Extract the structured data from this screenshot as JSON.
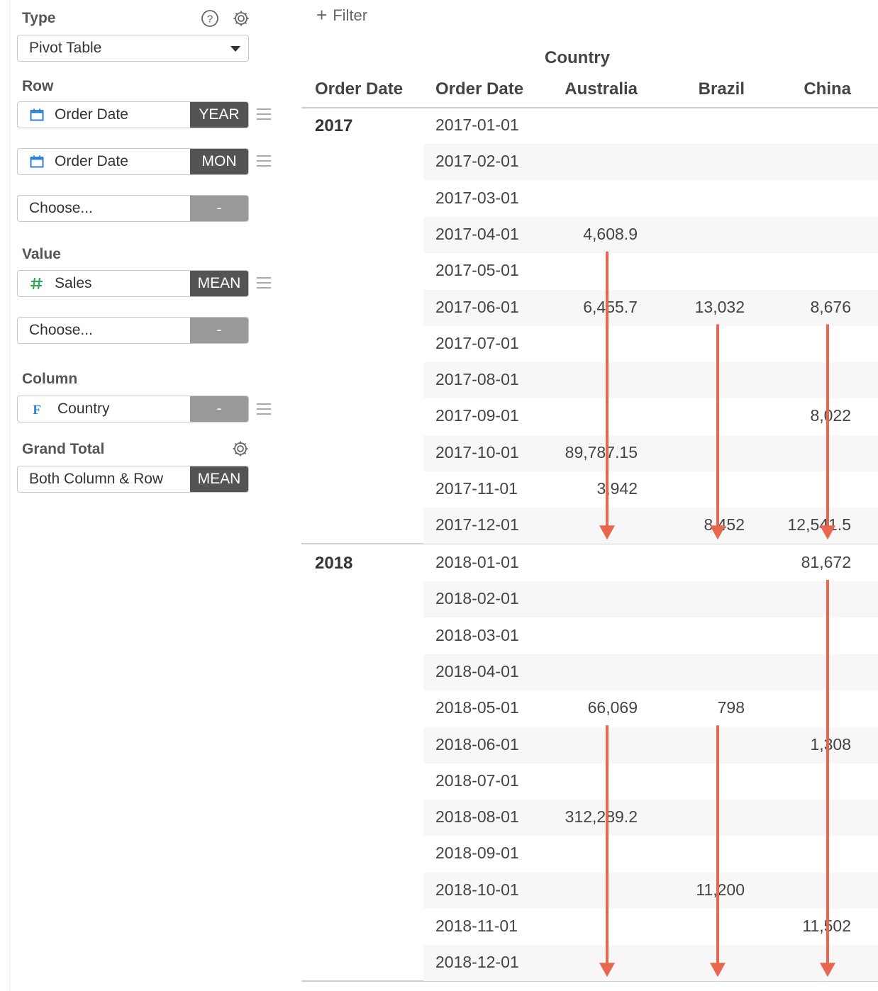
{
  "panel": {
    "type": {
      "label": "Type",
      "value": "Pivot Table"
    },
    "row": {
      "label": "Row",
      "fields": [
        {
          "name": "Order Date",
          "tag": "YEAR",
          "icon": "calendar-icon"
        },
        {
          "name": "Order Date",
          "tag": "MON",
          "icon": "calendar-icon"
        },
        {
          "name": "Choose...",
          "tag": "-"
        }
      ]
    },
    "value": {
      "label": "Value",
      "fields": [
        {
          "name": "Sales",
          "tag": "MEAN",
          "icon": "hash-icon"
        },
        {
          "name": "Choose...",
          "tag": "-"
        }
      ]
    },
    "column": {
      "label": "Column",
      "fields": [
        {
          "name": "Country",
          "tag": "-",
          "icon": "function-icon"
        }
      ]
    },
    "grand_total": {
      "label": "Grand Total",
      "value": "Both Column & Row",
      "tag": "MEAN"
    }
  },
  "toolbar": {
    "filter_label": "Filter"
  },
  "table": {
    "column_group": "Country",
    "headers": [
      "Order Date",
      "Order Date",
      "Australia",
      "Brazil",
      "China"
    ],
    "groups": [
      {
        "year": "2017",
        "rows": [
          {
            "date": "2017-01-01",
            "australia": "",
            "brazil": "",
            "china": ""
          },
          {
            "date": "2017-02-01",
            "australia": "",
            "brazil": "",
            "china": ""
          },
          {
            "date": "2017-03-01",
            "australia": "",
            "brazil": "",
            "china": ""
          },
          {
            "date": "2017-04-01",
            "australia": "4,608.9",
            "brazil": "",
            "china": ""
          },
          {
            "date": "2017-05-01",
            "australia": "",
            "brazil": "",
            "china": ""
          },
          {
            "date": "2017-06-01",
            "australia": "6,455.7",
            "brazil": "13,032",
            "china": "8,676"
          },
          {
            "date": "2017-07-01",
            "australia": "",
            "brazil": "",
            "china": ""
          },
          {
            "date": "2017-08-01",
            "australia": "",
            "brazil": "",
            "china": ""
          },
          {
            "date": "2017-09-01",
            "australia": "",
            "brazil": "",
            "china": "8,022"
          },
          {
            "date": "2017-10-01",
            "australia": "89,787.15",
            "brazil": "",
            "china": ""
          },
          {
            "date": "2017-11-01",
            "australia": "3,942",
            "brazil": "",
            "china": ""
          },
          {
            "date": "2017-12-01",
            "australia": "",
            "brazil": "8,452",
            "china": "12,541.5"
          }
        ]
      },
      {
        "year": "2018",
        "rows": [
          {
            "date": "2018-01-01",
            "australia": "",
            "brazil": "",
            "china": "81,672"
          },
          {
            "date": "2018-02-01",
            "australia": "",
            "brazil": "",
            "china": ""
          },
          {
            "date": "2018-03-01",
            "australia": "",
            "brazil": "",
            "china": ""
          },
          {
            "date": "2018-04-01",
            "australia": "",
            "brazil": "",
            "china": ""
          },
          {
            "date": "2018-05-01",
            "australia": "66,069",
            "brazil": "798",
            "china": ""
          },
          {
            "date": "2018-06-01",
            "australia": "",
            "brazil": "",
            "china": "1,308"
          },
          {
            "date": "2018-07-01",
            "australia": "",
            "brazil": "",
            "china": ""
          },
          {
            "date": "2018-08-01",
            "australia": "312,289.2",
            "brazil": "",
            "china": ""
          },
          {
            "date": "2018-09-01",
            "australia": "",
            "brazil": "",
            "china": ""
          },
          {
            "date": "2018-10-01",
            "australia": "",
            "brazil": "11,200",
            "china": ""
          },
          {
            "date": "2018-11-01",
            "australia": "",
            "brazil": "",
            "china": "11,502"
          },
          {
            "date": "2018-12-01",
            "australia": "",
            "brazil": "",
            "china": ""
          }
        ]
      }
    ]
  },
  "annotations": {
    "arrow_color": "#e8684f",
    "arrows": [
      {
        "column": "Australia",
        "from_date": "2017-04-01",
        "to_date": "2017-12-01"
      },
      {
        "column": "Brazil",
        "from_date": "2017-06-01",
        "to_date": "2017-12-01"
      },
      {
        "column": "China",
        "from_date": "2017-06-01",
        "to_date": "2017-12-01"
      },
      {
        "column": "Australia",
        "from_date": "2018-05-01",
        "to_date": "2018-12-01"
      },
      {
        "column": "Brazil",
        "from_date": "2018-05-01",
        "to_date": "2018-12-01"
      },
      {
        "column": "China",
        "from_date": "2018-01-01",
        "to_date": "2018-12-01"
      }
    ]
  }
}
